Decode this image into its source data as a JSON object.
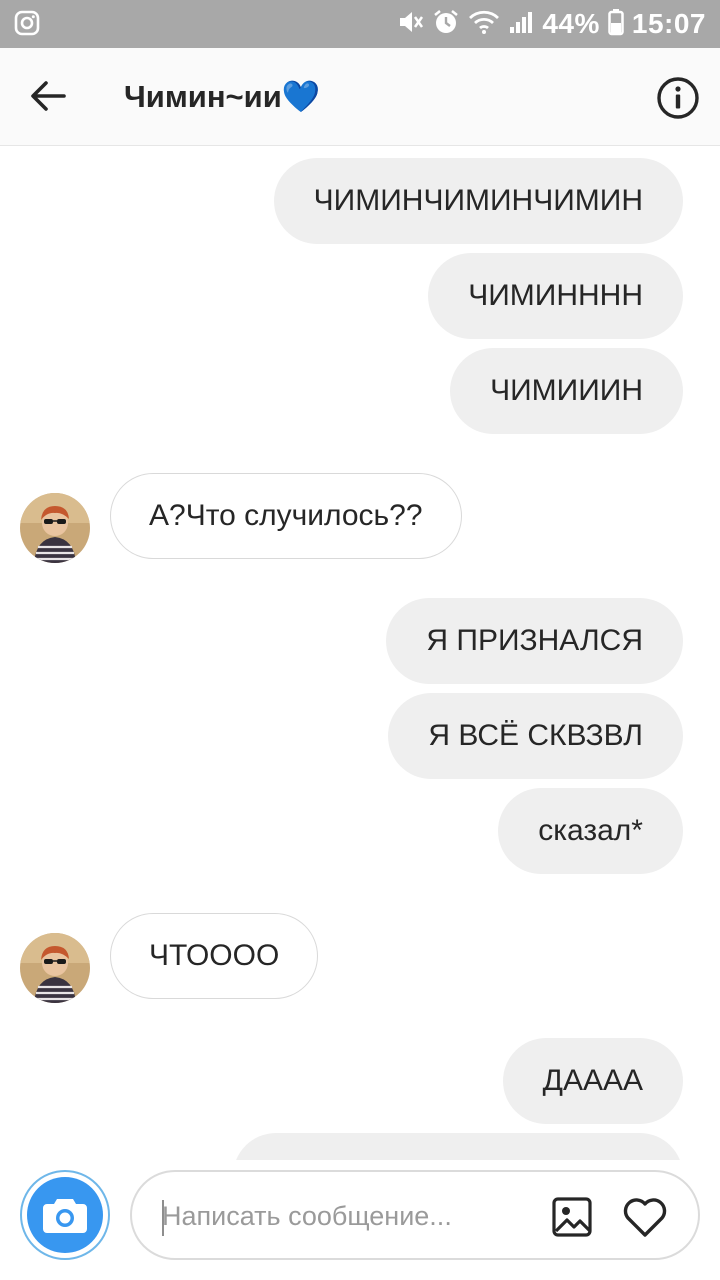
{
  "status_bar": {
    "battery": "44%",
    "time": "15:07"
  },
  "header": {
    "title": "Чимин~ии💙"
  },
  "messages": [
    {
      "side": "out",
      "text": "ЧИМИНЧИМИНЧИМИН"
    },
    {
      "side": "out",
      "text": "ЧИМИНННН"
    },
    {
      "side": "out",
      "text": "ЧИМИИИН"
    },
    {
      "side": "in",
      "text": "А?Что случилось??"
    },
    {
      "side": "out",
      "text": "Я ПРИЗНАЛСЯ"
    },
    {
      "side": "out",
      "text": "Я ВСЁ СКВЗВЛ"
    },
    {
      "side": "out",
      "text": "сказал*"
    },
    {
      "side": "in",
      "text": "ЧТОООО"
    },
    {
      "side": "out",
      "text": "ДАААА"
    }
  ],
  "composer": {
    "placeholder": "Написать сообщение..."
  },
  "icons": {
    "back": "arrow-left-icon",
    "info": "info-circle-icon",
    "camera": "camera-icon",
    "gallery": "image-icon",
    "like": "heart-icon"
  },
  "colors": {
    "status_bar": "#a8a8a8",
    "outgoing_bubble": "#efefef",
    "incoming_border": "#d9d9d9",
    "camera_accent": "#3897f0"
  }
}
